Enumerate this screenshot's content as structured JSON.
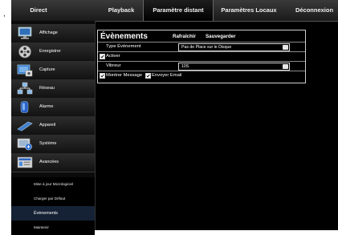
{
  "nav": {
    "tabs": [
      {
        "label": "Direct"
      },
      {
        "label": "Playback"
      },
      {
        "label": "Paramètre distant"
      },
      {
        "label": "Paramètres Locaux"
      },
      {
        "label": "Déconnexion"
      }
    ],
    "active_tab": "Paramètre distant"
  },
  "sidebar": {
    "items": [
      {
        "label": "Affichage",
        "icon": "monitor-icon"
      },
      {
        "label": "Enregistrer",
        "icon": "film-reel-icon"
      },
      {
        "label": "Capture",
        "icon": "capture-icon"
      },
      {
        "label": "Réseau",
        "icon": "network-icon"
      },
      {
        "label": "Alarme",
        "icon": "alarm-icon"
      },
      {
        "label": "Appareil",
        "icon": "device-icon"
      },
      {
        "label": "Système",
        "icon": "system-icon"
      },
      {
        "label": "Avancées",
        "icon": "advanced-icon"
      }
    ],
    "subitems": [
      {
        "label": "Mise à jour Micrologiciel"
      },
      {
        "label": "Charger par Défaut"
      },
      {
        "label": "Évènements",
        "active": true
      },
      {
        "label": "Maintenir"
      }
    ]
  },
  "panel": {
    "title": "Évènements",
    "refresh_label": "Rafraîchir",
    "save_label": "Sauvegarder",
    "event_type_label": "Type Évènement",
    "event_type_value": "Pas de Place sur le Disque",
    "enable_label": "Activer",
    "enable_checked": true,
    "buzzer_label": "Vibreur",
    "buzzer_value": "10S",
    "show_message_label": "Montrer Message",
    "show_message_checked": true,
    "send_email_label": "Envoyer Email",
    "send_email_checked": true
  },
  "page_prefix": ","
}
